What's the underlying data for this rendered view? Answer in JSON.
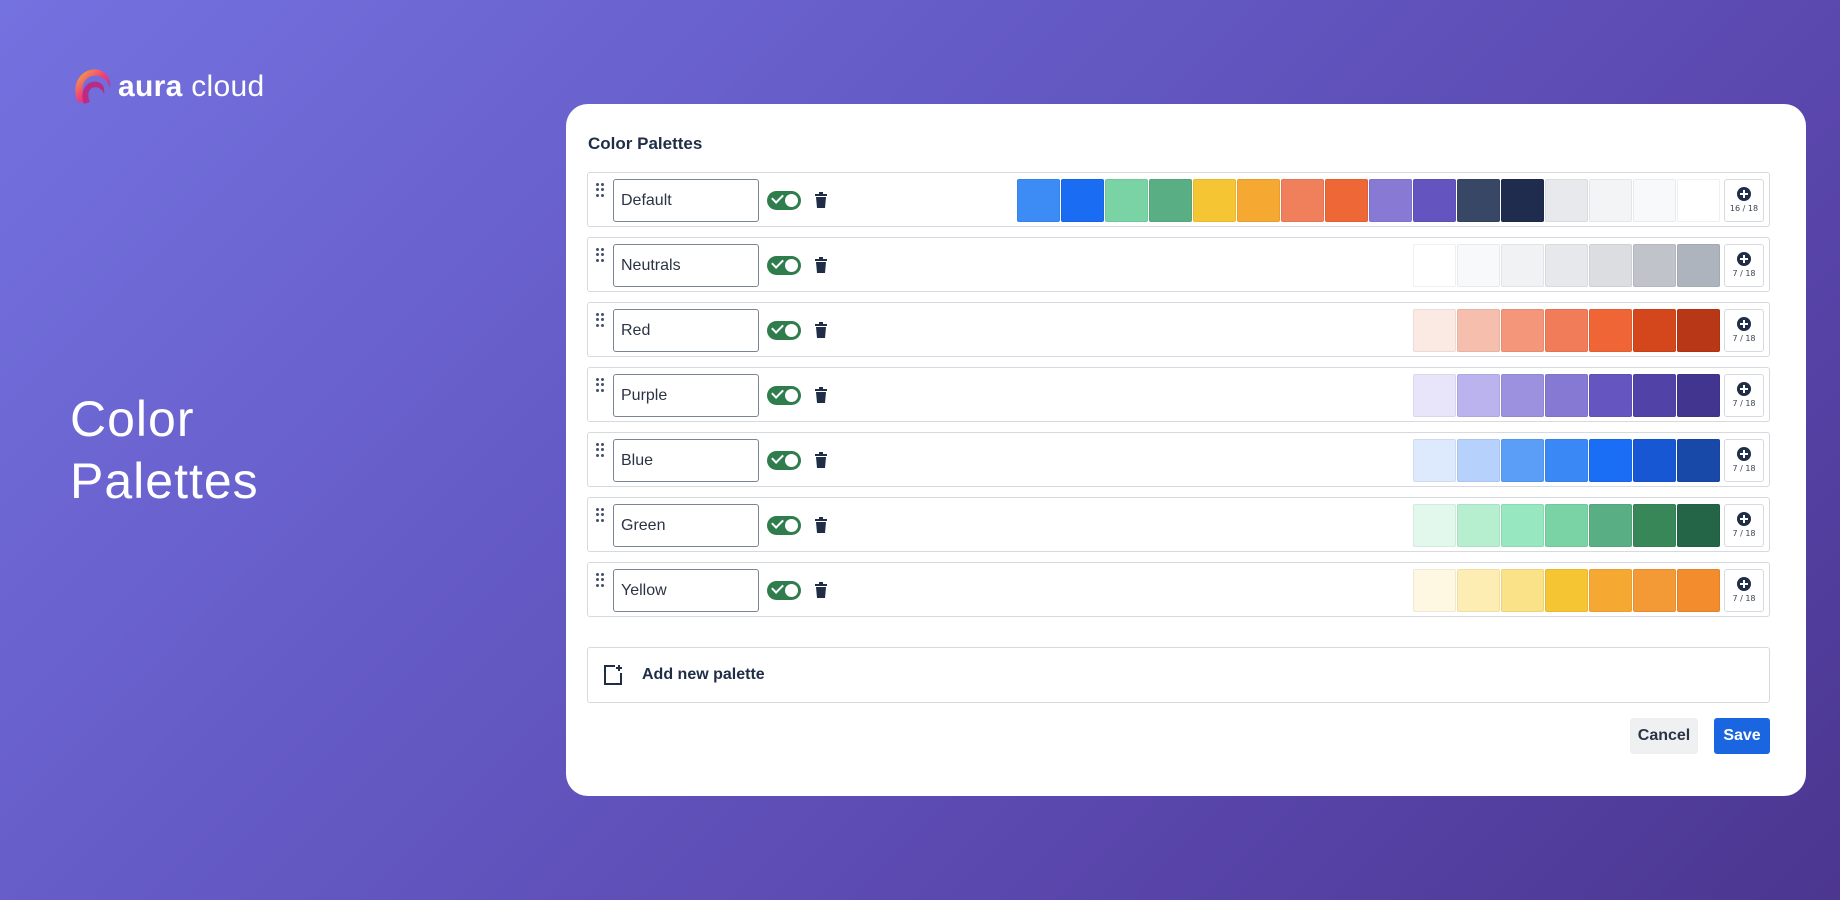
{
  "brand": {
    "name_bold": "aura",
    "name_light": "cloud"
  },
  "hero": {
    "line1": "Color",
    "line2": "Palettes"
  },
  "card": {
    "title": "Color Palettes"
  },
  "palettes": [
    {
      "name": "Default",
      "enabled": true,
      "count": "16 / 18",
      "colors": [
        "#3d8bf5",
        "#1a6cf2",
        "#79d3a4",
        "#5aae83",
        "#f6c534",
        "#f5a832",
        "#f07f5c",
        "#ee6737",
        "#8779d4",
        "#6454c0",
        "#384766",
        "#1f2c4d",
        "#e8e9ec",
        "#f3f4f5",
        "#f8f9fa",
        "#ffffff"
      ]
    },
    {
      "name": "Neutrals",
      "enabled": true,
      "count": "7 / 18",
      "colors": [
        "#ffffff",
        "#f8f9fa",
        "#f1f2f4",
        "#e7e8eb",
        "#dcdde0",
        "#c0c4ca",
        "#aeb4bd"
      ]
    },
    {
      "name": "Red",
      "enabled": true,
      "count": "7 / 18",
      "colors": [
        "#fbe9e4",
        "#f6bfad",
        "#f3967a",
        "#f07c5a",
        "#ef6536",
        "#d4461c",
        "#b83716"
      ]
    },
    {
      "name": "Purple",
      "enabled": true,
      "count": "7 / 18",
      "colors": [
        "#e8e5fa",
        "#bab3ee",
        "#9b91de",
        "#8679d4",
        "#6555c1",
        "#5142a8",
        "#42358f"
      ]
    },
    {
      "name": "Blue",
      "enabled": true,
      "count": "7 / 18",
      "colors": [
        "#dde9fd",
        "#b6d1fb",
        "#5b9ef8",
        "#3a88f5",
        "#1a6df5",
        "#1757d4",
        "#1849a9"
      ]
    },
    {
      "name": "Green",
      "enabled": true,
      "count": "7 / 18",
      "colors": [
        "#e3f8ec",
        "#b6efd0",
        "#97e7c0",
        "#79d3a5",
        "#5aae83",
        "#388759",
        "#246447"
      ]
    },
    {
      "name": "Yellow",
      "enabled": true,
      "count": "7 / 18",
      "colors": [
        "#fef7e2",
        "#fdedb3",
        "#fae289",
        "#f5c534",
        "#f5a933",
        "#f39a36",
        "#f28c2c"
      ]
    }
  ],
  "add_palette": {
    "label": "Add new palette"
  },
  "actions": {
    "cancel": "Cancel",
    "save": "Save"
  },
  "icons": {
    "drag": "drag-handle-icon",
    "toggle": "toggle-on-icon",
    "trash": "trash-icon",
    "add": "plus-circle-icon",
    "new_palette": "new-document-icon"
  }
}
